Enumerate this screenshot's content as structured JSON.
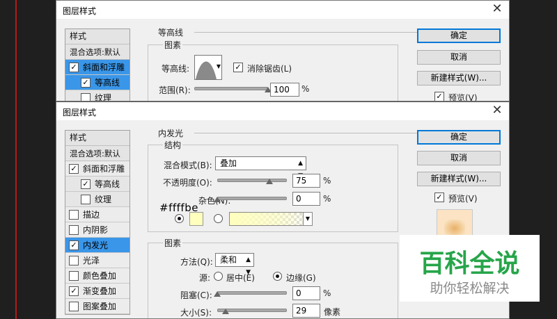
{
  "dialog_top": {
    "title": "图层样式",
    "close_glyph": "✕",
    "styles_header": "样式",
    "blend_options": "混合选项:默认",
    "items": [
      {
        "label": "斜面和浮雕",
        "checked": true
      },
      {
        "label": "等高线",
        "checked": true
      },
      {
        "label": "纹理",
        "checked": false
      }
    ],
    "section_title": "等高线",
    "group_title": "图素",
    "contour_label": "等高线:",
    "antialias_label": "消除锯齿(L)",
    "range_label": "范围(R):",
    "range_value": "100",
    "range_unit": "%",
    "range_fraction": 1.0,
    "buttons": {
      "ok": "确定",
      "cancel": "取消",
      "new_style": "新建样式(W)...",
      "preview": "预览(V)"
    }
  },
  "dialog_bottom": {
    "title": "图层样式",
    "close_glyph": "✕",
    "styles_header": "样式",
    "blend_options": "混合选项:默认",
    "items": [
      {
        "label": "斜面和浮雕",
        "checked": true
      },
      {
        "label": "等高线",
        "checked": true
      },
      {
        "label": "纹理",
        "checked": false
      },
      {
        "label": "描边",
        "checked": false
      },
      {
        "label": "内阴影",
        "checked": false
      },
      {
        "label": "内发光",
        "checked": true
      },
      {
        "label": "光泽",
        "checked": false
      },
      {
        "label": "颜色叠加",
        "checked": false
      },
      {
        "label": "渐变叠加",
        "checked": true
      },
      {
        "label": "图案叠加",
        "checked": false
      }
    ],
    "section_title": "内发光",
    "structure": {
      "group_title": "结构",
      "blend_mode_label": "混合模式(B):",
      "blend_mode_value": "叠加",
      "opacity_label": "不透明度(O):",
      "opacity_value": "75",
      "opacity_unit": "%",
      "opacity_fraction": 0.75,
      "noise_label": "杂色(N):",
      "noise_value": "0",
      "noise_unit": "%",
      "noise_fraction": 0.0,
      "color_hex": "#ffffbe"
    },
    "elements": {
      "group_title": "图素",
      "method_label": "方法(Q):",
      "method_value": "柔和",
      "source_label": "源:",
      "source_center": "居中(E)",
      "source_edge": "边缘(G)",
      "choke_label": "阻塞(C):",
      "choke_value": "0",
      "choke_unit": "%",
      "choke_fraction": 0.0,
      "size_label": "大小(S):",
      "size_value": "29",
      "size_unit": "像素",
      "size_fraction": 0.116
    },
    "buttons": {
      "ok": "确定",
      "cancel": "取消",
      "new_style": "新建样式(W)...",
      "preview": "预览(V)"
    }
  },
  "watermark": {
    "title": "百科全说",
    "subtitle": "助你轻松解决"
  },
  "colors": {
    "accent": "#3a96e8",
    "default_button": "#0078d7",
    "glow": "#ffffbe",
    "watermark_green": "#27a54a"
  }
}
